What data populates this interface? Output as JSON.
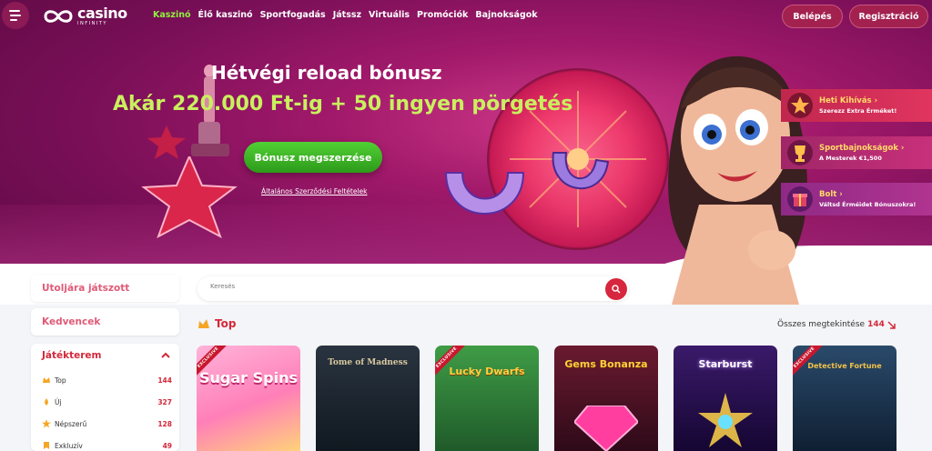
{
  "header": {
    "logo_main": "casino",
    "logo_sub": "INFINITY",
    "nav": [
      "Kaszinó",
      "Élő kaszinó",
      "Sportfogadás",
      "Játssz",
      "Virtuális",
      "Promóciók",
      "Bajnokságok"
    ],
    "login_label": "Belépés",
    "register_label": "Regisztráció"
  },
  "hero": {
    "title": "Hétvégi reload bónusz",
    "subtitle": "Akár 220.000 Ft-ig + 50 ingyen pörgetés",
    "cta_label": "Bónusz megszerzése",
    "terms_label": "Általános Szerződési Feltételek"
  },
  "promos": [
    {
      "title": "Heti Kihívás ›",
      "desc": "Szerezz Extra Érméket!"
    },
    {
      "title": "Sportbajnokságok ›",
      "desc": "A Mesterek €1,500"
    },
    {
      "title": "Bolt ›",
      "desc": "Váltsd Érméidet Bónuszokra!"
    }
  ],
  "sidebar": {
    "last_played": "Utoljára játszott",
    "favorites": "Kedvencek",
    "game_room": "Játékterem",
    "items": [
      {
        "label": "Top",
        "count": "144",
        "icon": "crown-icon"
      },
      {
        "label": "Új",
        "count": "327",
        "icon": "new-icon"
      },
      {
        "label": "Népszerű",
        "count": "128",
        "icon": "star-icon"
      },
      {
        "label": "Exkluzív",
        "count": "49",
        "icon": "exclusive-icon"
      }
    ]
  },
  "search": {
    "placeholder": "Keresés"
  },
  "section": {
    "title": "Top",
    "see_all_label": "Összes megtekintése",
    "see_all_count": "144"
  },
  "games": [
    {
      "name": "Sugar Spins",
      "badge": "EXCLUSIVE",
      "bg": "#ff8fc2"
    },
    {
      "name": "Tome of Madness",
      "badge": "",
      "bg": "#1b2531"
    },
    {
      "name": "Lucky Dwarfs",
      "badge": "EXCLUSIVE",
      "bg": "#2e7a3a"
    },
    {
      "name": "Gems Bonanza",
      "badge": "",
      "bg": "#5a1a2a"
    },
    {
      "name": "Starburst",
      "badge": "",
      "bg": "#2a1150"
    },
    {
      "name": "Detective Fortune",
      "badge": "EXCLUSIVE",
      "bg": "#1d3a55"
    }
  ],
  "colors": {
    "accent": "#d4283a",
    "active_nav": "#8ef23f",
    "cta": "#3cb42a"
  }
}
